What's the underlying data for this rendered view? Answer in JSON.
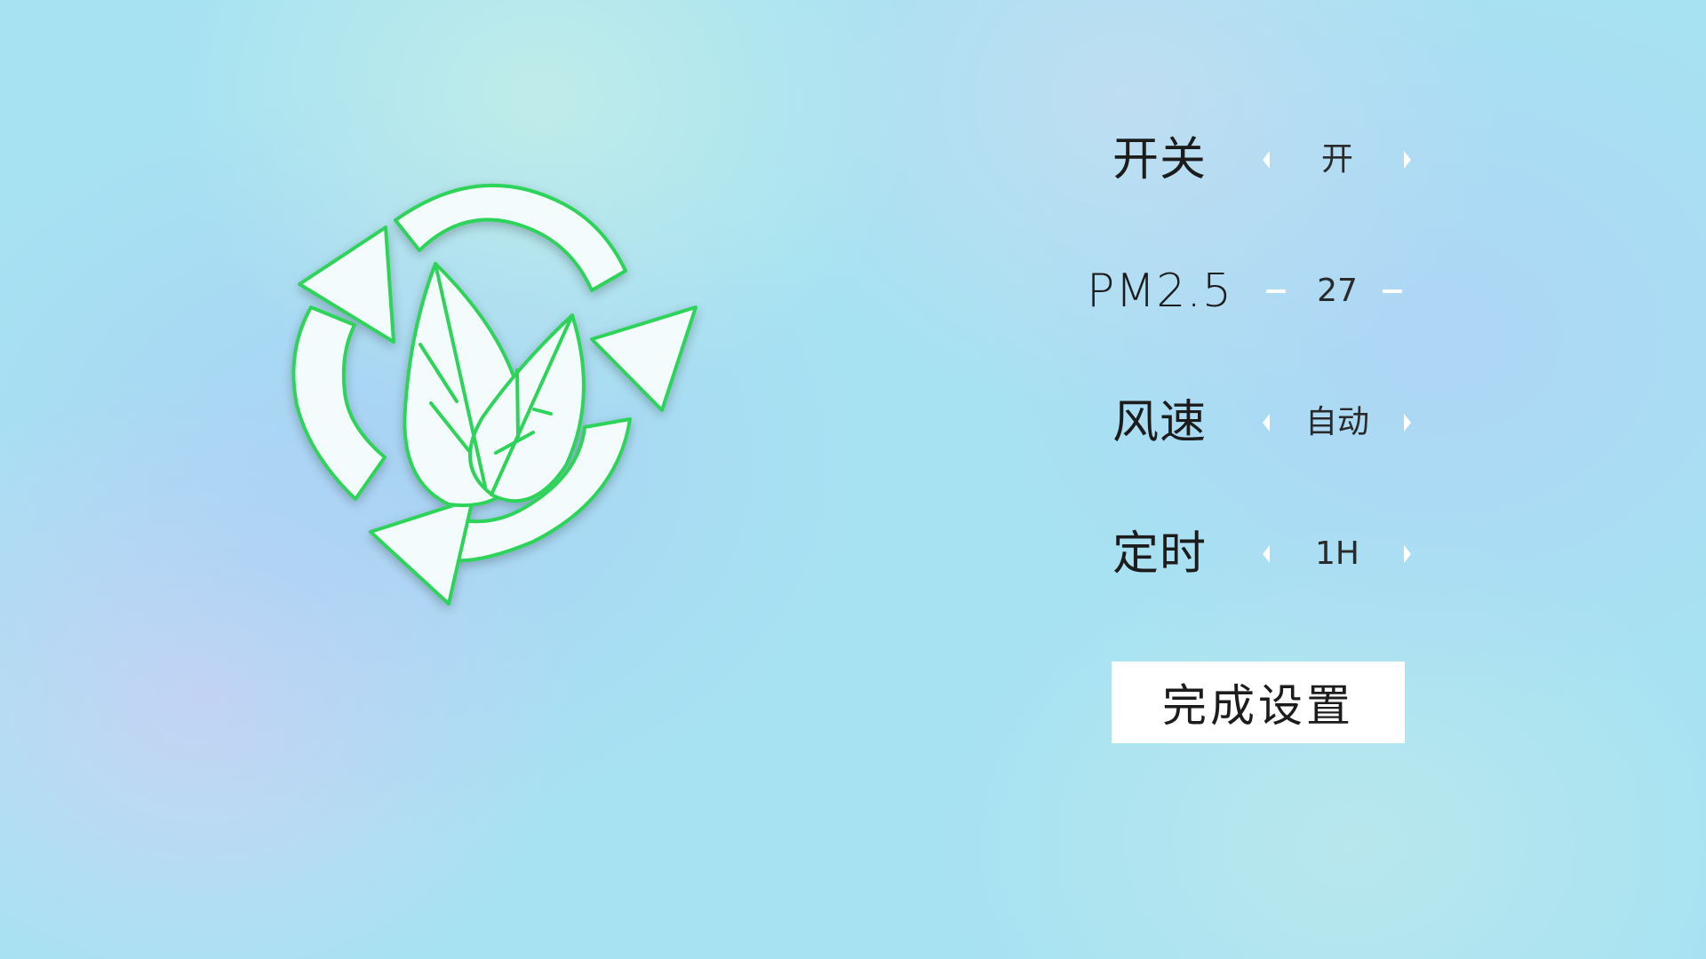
{
  "logo": {
    "icon": "recycle-leaves-icon",
    "stroke_color": "#2fd35a",
    "fill_color": "#f4fbfd"
  },
  "settings": {
    "power": {
      "label": "开关",
      "value": "开"
    },
    "pm25": {
      "label": "PM2.5",
      "value": "27"
    },
    "fan_speed": {
      "label": "风速",
      "value": "自动"
    },
    "timer": {
      "label": "定时",
      "value": "1H"
    }
  },
  "done_button": {
    "label": "完成设置"
  },
  "colors": {
    "background": "#a7e2f2",
    "text": "#1c1c1c",
    "control": "#ffffff",
    "accent": "#2fd35a"
  }
}
